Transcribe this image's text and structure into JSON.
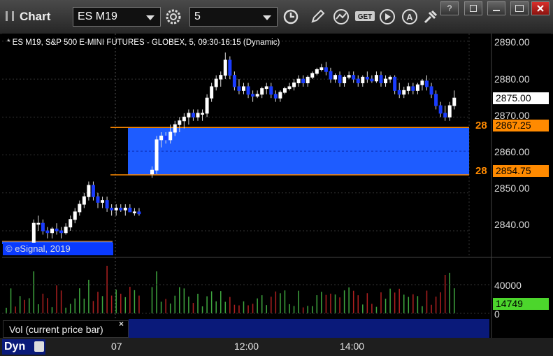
{
  "window": {
    "title": "Chart",
    "buttons": {
      "help": "?",
      "restore": "",
      "minimize": "",
      "close": ""
    }
  },
  "toolbar": {
    "symbol": "ES M19",
    "interval": "5",
    "icons": [
      "settings-icon",
      "clock-icon",
      "pencil-icon",
      "indicator-icon",
      "get-icon",
      "play-icon",
      "alert-icon",
      "link-icon"
    ]
  },
  "chart": {
    "header": "* ES M19, S&P 500 E-MINI FUTURES - GLOBEX, 5, 09:30-16:15 (Dynamic)",
    "copyright": "© eSignal, 2019",
    "price_axis": [
      "2890.00",
      "2880.00",
      "2870.00",
      "2860.00",
      "2850.00",
      "2840.00"
    ],
    "last_price": "2875.00",
    "zone_top": "2867.25",
    "zone_bottom": "2854.75",
    "zone_top_left": "28",
    "zone_bottom_left": "28",
    "vol_axis": [
      "40000",
      "0"
    ],
    "vol_last": "14749",
    "vol_label": "Vol (current price bar)",
    "vol_close": "×",
    "time_labels": [
      "07",
      "12:00",
      "14:00"
    ],
    "mode": "Dyn",
    "colors": {
      "up": "#ffffff",
      "down": "#1a3cff",
      "zone": "#1e5cff",
      "zone_line": "#ff8a00",
      "vol_up": "#3fa83f",
      "vol_down": "#b02020"
    }
  },
  "chart_data": {
    "type": "candlestick",
    "title": "ES M19, S&P 500 E-MINI FUTURES - GLOBEX, 5, 09:30-16:15 (Dynamic)",
    "ylim": [
      2833,
      2892
    ],
    "zone": [
      2854.75,
      2867.25
    ],
    "session_start_index": 30,
    "ohlc": [
      [
        2835,
        2836,
        2834,
        2835
      ],
      [
        2835,
        2836,
        2834,
        2835.5
      ],
      [
        2835.5,
        2836,
        2834.5,
        2835
      ],
      [
        2835,
        2836,
        2834,
        2835.5
      ],
      [
        2835.5,
        2836,
        2834,
        2835
      ],
      [
        2835,
        2836.5,
        2834,
        2836
      ],
      [
        2836,
        2843,
        2835,
        2842
      ],
      [
        2842,
        2844,
        2840,
        2842
      ],
      [
        2842,
        2843,
        2839,
        2840
      ],
      [
        2840,
        2841,
        2838,
        2839.5
      ],
      [
        2839.5,
        2841,
        2838,
        2840.5
      ],
      [
        2840.5,
        2842,
        2839,
        2840
      ],
      [
        2840,
        2841,
        2838,
        2839.5
      ],
      [
        2839.5,
        2842,
        2839,
        2841
      ],
      [
        2841,
        2844,
        2840,
        2843
      ],
      [
        2843,
        2846,
        2842,
        2845
      ],
      [
        2845,
        2848,
        2844,
        2847
      ],
      [
        2847,
        2850,
        2846,
        2849
      ],
      [
        2849,
        2853,
        2848,
        2852
      ],
      [
        2852,
        2853,
        2848,
        2849
      ],
      [
        2849,
        2850,
        2846,
        2847.5
      ],
      [
        2847.5,
        2849,
        2846,
        2848
      ],
      [
        2848,
        2849,
        2845,
        2846
      ],
      [
        2846,
        2847,
        2844,
        2845.5
      ],
      [
        2845.5,
        2847,
        2844,
        2846
      ],
      [
        2846,
        2847,
        2845,
        2845.5
      ],
      [
        2845.5,
        2847,
        2844,
        2846
      ],
      [
        2846,
        2847,
        2845,
        2845
      ],
      [
        2845,
        2846,
        2844,
        2845
      ],
      [
        2845,
        2846,
        2844,
        2844.5
      ],
      [
        2855,
        2857,
        2854,
        2856
      ],
      [
        2856,
        2865,
        2855,
        2864
      ],
      [
        2864,
        2866,
        2862,
        2865
      ],
      [
        2865,
        2866,
        2863,
        2864
      ],
      [
        2864,
        2868,
        2863,
        2866
      ],
      [
        2866,
        2869,
        2865,
        2868
      ],
      [
        2868,
        2870,
        2866,
        2869
      ],
      [
        2869,
        2871,
        2867,
        2870
      ],
      [
        2870,
        2872,
        2868,
        2871
      ],
      [
        2871,
        2872,
        2869,
        2870
      ],
      [
        2870,
        2872,
        2869,
        2871
      ],
      [
        2871,
        2872,
        2869,
        2871
      ],
      [
        2871,
        2876,
        2870,
        2875
      ],
      [
        2875,
        2879,
        2874,
        2878
      ],
      [
        2878,
        2881,
        2877,
        2880
      ],
      [
        2880,
        2882,
        2878,
        2881
      ],
      [
        2881,
        2887,
        2880,
        2885
      ],
      [
        2885,
        2886,
        2880,
        2881
      ],
      [
        2881,
        2882,
        2877,
        2878
      ],
      [
        2878,
        2880,
        2876,
        2877
      ],
      [
        2877,
        2879,
        2876,
        2878
      ],
      [
        2878,
        2879,
        2875,
        2876
      ],
      [
        2876,
        2877,
        2874,
        2875.5
      ],
      [
        2875.5,
        2877,
        2875,
        2876
      ],
      [
        2876,
        2878,
        2875,
        2877.5
      ],
      [
        2877.5,
        2879,
        2876,
        2878
      ],
      [
        2878,
        2879,
        2875,
        2876
      ],
      [
        2876,
        2877,
        2874,
        2875
      ],
      [
        2875,
        2877,
        2874,
        2876.5
      ],
      [
        2876.5,
        2878,
        2876,
        2877.5
      ],
      [
        2877.5,
        2879,
        2877,
        2878
      ],
      [
        2878,
        2880,
        2877,
        2879
      ],
      [
        2879,
        2881,
        2878,
        2880
      ],
      [
        2880,
        2881,
        2878,
        2879
      ],
      [
        2879,
        2881,
        2878,
        2880.5
      ],
      [
        2880.5,
        2882,
        2880,
        2881.5
      ],
      [
        2881.5,
        2883,
        2881,
        2882.5
      ],
      [
        2882.5,
        2884,
        2882,
        2883
      ],
      [
        2883,
        2884.5,
        2881,
        2882
      ],
      [
        2882,
        2883,
        2879,
        2880
      ],
      [
        2880,
        2881.5,
        2879,
        2881
      ],
      [
        2881,
        2882,
        2878,
        2879
      ],
      [
        2879,
        2881,
        2878,
        2880.5
      ],
      [
        2880.5,
        2882,
        2880,
        2881
      ],
      [
        2881,
        2882,
        2879,
        2880
      ],
      [
        2880,
        2881,
        2878,
        2879
      ],
      [
        2879,
        2881,
        2878,
        2880.5
      ],
      [
        2880.5,
        2882,
        2879,
        2880
      ],
      [
        2880,
        2881,
        2879,
        2879.5
      ],
      [
        2879.5,
        2882,
        2879,
        2881
      ],
      [
        2881,
        2882,
        2878,
        2879
      ],
      [
        2879,
        2881,
        2878,
        2880
      ],
      [
        2880,
        2881,
        2879,
        2880.5
      ],
      [
        2880.5,
        2881,
        2876,
        2877
      ],
      [
        2877,
        2879,
        2875,
        2876
      ],
      [
        2876,
        2878,
        2875,
        2877
      ],
      [
        2877,
        2879,
        2876,
        2878
      ],
      [
        2878,
        2879,
        2876,
        2877
      ],
      [
        2877,
        2879,
        2876,
        2878.5
      ],
      [
        2878.5,
        2880,
        2877,
        2879.5
      ],
      [
        2879.5,
        2881,
        2877,
        2878
      ],
      [
        2878,
        2879,
        2875,
        2876
      ],
      [
        2876,
        2877,
        2872,
        2873
      ],
      [
        2873,
        2874,
        2870,
        2871
      ],
      [
        2871,
        2873,
        2869,
        2870
      ],
      [
        2870,
        2874,
        2869,
        2873
      ],
      [
        2873,
        2877,
        2872,
        2875
      ]
    ]
  }
}
